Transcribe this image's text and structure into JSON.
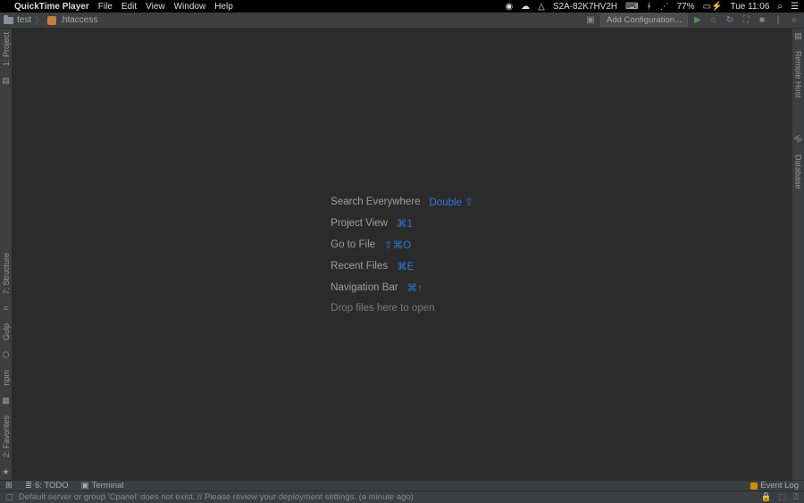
{
  "mac_menu": {
    "apple": "",
    "app_name": "QuickTime Player",
    "items": [
      "File",
      "Edit",
      "View",
      "Window",
      "Help"
    ],
    "status_right": {
      "host": "S2A-82K7HV2H",
      "battery": "77%",
      "time": "Tue 11:06"
    }
  },
  "breadcrumb": {
    "project": "test",
    "file": ".htaccess"
  },
  "toolbar": {
    "add_config": "Add Configuration..."
  },
  "left_strip": {
    "project": "1: Project",
    "structure": "7: Structure",
    "gulp": "Gulp",
    "npm": "npm",
    "favorites": "2: Favorites"
  },
  "right_strip": {
    "remote_host": "Remote Host",
    "database": "Database"
  },
  "welcome": {
    "search_everywhere": {
      "label": "Search Everywhere",
      "shortcut": "Double ⇧"
    },
    "project_view": {
      "label": "Project View",
      "shortcut": "⌘1"
    },
    "go_to_file": {
      "label": "Go to File",
      "shortcut": "⇧⌘O"
    },
    "recent_files": {
      "label": "Recent Files",
      "shortcut": "⌘E"
    },
    "navigation_bar": {
      "label": "Navigation Bar",
      "shortcut": "⌘↑"
    },
    "drop_files": {
      "label": "Drop files here to open"
    }
  },
  "bottom_tabs": {
    "todo": "6: TODO",
    "terminal": "Terminal",
    "event_log": "Event Log"
  },
  "status": {
    "message": "Default server or group 'Cpanel' does not exist. // Please review your deployment settings. (a minute ago)"
  }
}
